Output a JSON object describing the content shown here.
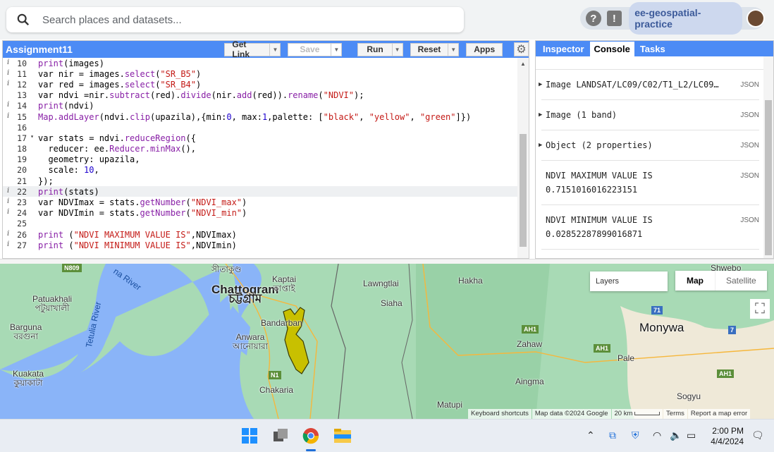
{
  "search": {
    "placeholder": "Search places and datasets..."
  },
  "account": {
    "help_icon": "?",
    "feedback_icon": "!",
    "project": "ee-geospatial-practice"
  },
  "editor": {
    "title": "Assignment11",
    "buttons": {
      "get_link": "Get Link",
      "save": "Save",
      "run": "Run",
      "reset": "Reset",
      "apps": "Apps"
    },
    "lines": [
      {
        "n": "10",
        "info": true,
        "seg": [
          [
            "print",
            "fn"
          ],
          [
            "(images)",
            "kw"
          ]
        ]
      },
      {
        "n": "11",
        "info": true,
        "seg": [
          [
            "var nir = images.",
            "kw"
          ],
          [
            "select",
            "fn"
          ],
          [
            "(",
            "kw"
          ],
          [
            "\"SR_B5\"",
            "str"
          ],
          [
            ")",
            "kw"
          ]
        ]
      },
      {
        "n": "12",
        "info": true,
        "seg": [
          [
            "var red = images.",
            "kw"
          ],
          [
            "select",
            "fn"
          ],
          [
            "(",
            "kw"
          ],
          [
            "\"SR_B4\"",
            "str"
          ],
          [
            ")",
            "kw"
          ]
        ]
      },
      {
        "n": "13",
        "info": false,
        "seg": [
          [
            "var ndvi =nir.",
            "kw"
          ],
          [
            "subtract",
            "fn"
          ],
          [
            "(red).",
            "kw"
          ],
          [
            "divide",
            "fn"
          ],
          [
            "(nir.",
            "kw"
          ],
          [
            "add",
            "fn"
          ],
          [
            "(red)).",
            "kw"
          ],
          [
            "rename",
            "fn"
          ],
          [
            "(",
            "kw"
          ],
          [
            "\"NDVI\"",
            "str"
          ],
          [
            ");",
            "kw"
          ]
        ]
      },
      {
        "n": "14",
        "info": true,
        "seg": [
          [
            "print",
            "fn"
          ],
          [
            "(ndvi)",
            "kw"
          ]
        ]
      },
      {
        "n": "15",
        "info": true,
        "seg": [
          [
            "Map.addLayer",
            "fn"
          ],
          [
            "(ndvi.",
            "kw"
          ],
          [
            "clip",
            "fn"
          ],
          [
            "(upazila),{min:",
            "kw"
          ],
          [
            "0",
            "num"
          ],
          [
            ", max:",
            "kw"
          ],
          [
            "1",
            "num"
          ],
          [
            ",palette: [",
            "kw"
          ],
          [
            "\"black\"",
            "str"
          ],
          [
            ", ",
            "kw"
          ],
          [
            "\"yellow\"",
            "str"
          ],
          [
            ", ",
            "kw"
          ],
          [
            "\"green\"",
            "str"
          ],
          [
            "]})",
            "kw"
          ]
        ]
      },
      {
        "n": "16",
        "info": false,
        "seg": []
      },
      {
        "n": "17",
        "info": false,
        "fold": true,
        "seg": [
          [
            "var stats = ndvi.",
            "kw"
          ],
          [
            "reduceRegion",
            "fn"
          ],
          [
            "({",
            "kw"
          ]
        ]
      },
      {
        "n": "18",
        "info": false,
        "seg": [
          [
            "  reducer: ee.",
            "kw"
          ],
          [
            "Reducer.minMax",
            "fn"
          ],
          [
            "(),",
            "kw"
          ]
        ]
      },
      {
        "n": "19",
        "info": false,
        "seg": [
          [
            "  geometry: upazila,",
            "kw"
          ]
        ]
      },
      {
        "n": "20",
        "info": false,
        "seg": [
          [
            "  scale: ",
            "kw"
          ],
          [
            "10",
            "num"
          ],
          [
            ",",
            "kw"
          ]
        ]
      },
      {
        "n": "21",
        "info": false,
        "seg": [
          [
            "});",
            "kw"
          ]
        ]
      },
      {
        "n": "22",
        "info": true,
        "hl": true,
        "seg": [
          [
            "print",
            "fn"
          ],
          [
            "(stats)",
            "kw"
          ]
        ]
      },
      {
        "n": "23",
        "info": true,
        "seg": [
          [
            "var NDVImax = stats.",
            "kw"
          ],
          [
            "getNumber",
            "fn"
          ],
          [
            "(",
            "kw"
          ],
          [
            "\"NDVI_max\"",
            "str"
          ],
          [
            ")",
            "kw"
          ]
        ]
      },
      {
        "n": "24",
        "info": true,
        "seg": [
          [
            "var NDVImin = stats.",
            "kw"
          ],
          [
            "getNumber",
            "fn"
          ],
          [
            "(",
            "kw"
          ],
          [
            "\"NDVI_min\"",
            "str"
          ],
          [
            ")",
            "kw"
          ]
        ]
      },
      {
        "n": "25",
        "info": false,
        "seg": []
      },
      {
        "n": "26",
        "info": true,
        "seg": [
          [
            "print ",
            "fn"
          ],
          [
            "(",
            "kw"
          ],
          [
            "\"NDVI MAXIMUM VALUE IS\"",
            "str"
          ],
          [
            ",NDVImax)",
            "kw"
          ]
        ]
      },
      {
        "n": "27",
        "info": true,
        "seg": [
          [
            "print ",
            "fn"
          ],
          [
            "(",
            "kw"
          ],
          [
            "\"NDVI MINIMUM VALUE IS\"",
            "str"
          ],
          [
            ",NDVImin)",
            "kw"
          ]
        ]
      }
    ]
  },
  "console": {
    "tabs": [
      "Inspector",
      "Console",
      "Tasks"
    ],
    "active_tab": "Console",
    "entries": [
      {
        "expandable": true,
        "text": "Image LANDSAT/LC09/C02/T1_L2/LC09…",
        "json": "JSON"
      },
      {
        "expandable": true,
        "text": "Image (1 band)",
        "json": "JSON"
      },
      {
        "expandable": true,
        "text": "Object (2 properties)",
        "json": "JSON"
      },
      {
        "expandable": false,
        "text": "NDVI MAXIMUM VALUE IS",
        "value": "0.7151016016223151",
        "json": "JSON"
      },
      {
        "expandable": false,
        "text": "NDVI MINIMUM VALUE IS",
        "value": "0.02852287899016871",
        "json": "JSON"
      }
    ]
  },
  "map": {
    "layers_label": "Layers",
    "map_type": [
      "Map",
      "Satellite"
    ],
    "selected_type": "Map",
    "labels": {
      "chattogram": "Chattogram",
      "chattogram_bn": "চট্টগ্রাম",
      "patuakhali": "Patuakhali",
      "patuakhali_bn": "পটুয়াখালী",
      "barguna": "Barguna",
      "barguna_bn": "বরগুনা",
      "kuakata": "Kuakata",
      "kuakata_bn": "কুয়াকাটা",
      "tetulia": "Tetulia River",
      "meghna": "na River",
      "sitakund_bn": "সীতাকুণ্ড",
      "kaptai": "Kaptai",
      "kaptai_bn": "কাপ্তাই",
      "bandarban": "Bandarban",
      "anwara": "Anwara",
      "anwara_bn": "আনোয়ারা",
      "chakaria": "Chakaria",
      "lawngtlai": "Lawngtlai",
      "siaha": "Siaha",
      "hakha": "Hakha",
      "zahaw": "Zahaw",
      "aingma": "Aingma",
      "matupi": "Matupi",
      "monywa": "Monywa",
      "pale": "Pale",
      "sogyu": "Sogyu",
      "shwebo": "Shwebo"
    },
    "shields": {
      "n809": "N809",
      "n1": "N1",
      "ah1a": "AH1",
      "ah1b": "AH1",
      "ah1c": "AH1",
      "r71": "71",
      "r7": "7"
    },
    "attribution": {
      "shortcuts": "Keyboard shortcuts",
      "data": "Map data ©2024 Google",
      "scale": "20 km",
      "terms": "Terms",
      "report": "Report a map error"
    },
    "ndvi_palette": [
      "#000000",
      "#ffff00",
      "#008000"
    ]
  },
  "taskbar": {
    "time": "2:00 PM",
    "date": "4/4/2024"
  }
}
